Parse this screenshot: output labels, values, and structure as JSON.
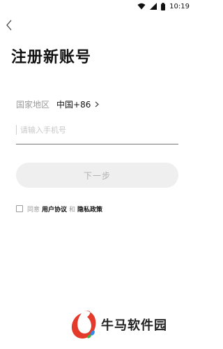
{
  "status_bar": {
    "time": "10:19"
  },
  "page": {
    "title": "注册新账号"
  },
  "country": {
    "label": "国家地区",
    "value": "中国+86"
  },
  "phone": {
    "placeholder": "请输入手机号",
    "value": ""
  },
  "next_button": {
    "label": "下一步"
  },
  "agreement": {
    "prefix": "同意",
    "user_agreement": "用户协议",
    "conjunction": "和",
    "privacy_policy": "隐私政策",
    "checked": false
  },
  "watermark": {
    "text": "牛马软件园"
  },
  "colors": {
    "accent_red": "#e33a2c",
    "button_bg": "#efefef",
    "muted": "#9a9a9a"
  },
  "icons": [
    "wifi-icon",
    "signal-icon",
    "battery-icon",
    "back-arrow-icon",
    "chevron-right-icon"
  ]
}
